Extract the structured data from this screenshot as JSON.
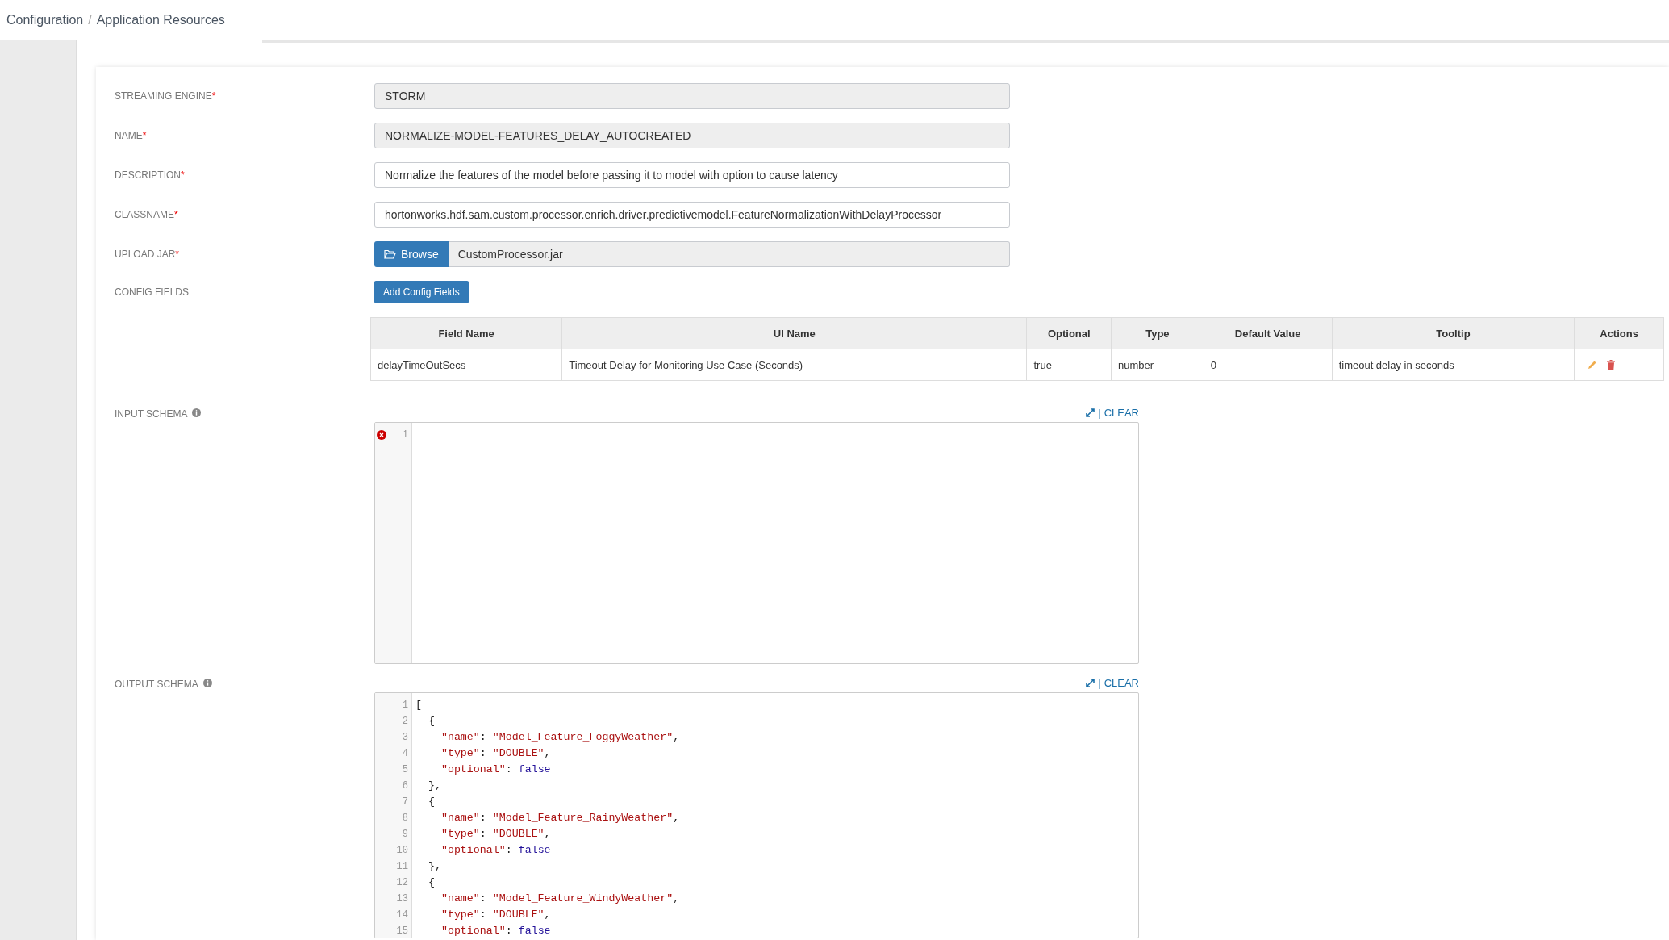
{
  "breadcrumb": [
    "Configuration",
    "Application Resources"
  ],
  "breadcrumb_separator": "/",
  "form": {
    "fields": [
      {
        "label": "STREAMING ENGINE",
        "required_mark": "*",
        "kind": "readonly",
        "value": "STORM"
      },
      {
        "label": "NAME",
        "required_mark": "*",
        "kind": "readonly",
        "value": "NORMALIZE-MODEL-FEATURES_DELAY_AUTOCREATED"
      },
      {
        "label": "DESCRIPTION",
        "required_mark": "*",
        "kind": "text",
        "value": "Normalize the features of the model before passing it to model with option to cause latency"
      },
      {
        "label": "CLASSNAME",
        "required_mark": "*",
        "kind": "text",
        "value": "hortonworks.hdf.sam.custom.processor.enrich.driver.predictivemodel.FeatureNormalizationWithDelayProcessor"
      },
      {
        "label": "UPLOAD JAR",
        "required_mark": "*",
        "kind": "file",
        "button": "Browse",
        "value": "CustomProcessor.jar"
      }
    ]
  },
  "config_fields": {
    "label": "CONFIG FIELDS",
    "button": "Add Config Fields",
    "columns": [
      "Field Name",
      "UI Name",
      "Optional",
      "Type",
      "Default Value",
      "Tooltip",
      "Actions"
    ],
    "rows": [
      {
        "cells": [
          "delayTimeOutSecs",
          "Timeout Delay for Monitoring Use Case (Seconds)",
          "true",
          "number",
          "0",
          "timeout delay in seconds"
        ]
      }
    ]
  },
  "schemas": [
    {
      "label": "INPUT SCHEMA",
      "separator": "|",
      "clear": "CLEAR",
      "error": true,
      "lines": [
        {
          "number": "1"
        }
      ]
    },
    {
      "label": "OUTPUT SCHEMA",
      "separator": "|",
      "clear": "CLEAR",
      "error": false,
      "lines": [
        {
          "number": "1",
          "tokens": [
            {
              "kind": "punct",
              "text": "["
            }
          ]
        },
        {
          "number": "2",
          "tokens": [
            {
              "kind": "punct",
              "text": "  {"
            }
          ]
        },
        {
          "number": "3",
          "tokens": [
            {
              "kind": "key",
              "text": "    \"name\""
            },
            {
              "kind": "punct",
              "text": ": "
            },
            {
              "kind": "string",
              "text": "\"Model_Feature_FoggyWeather\""
            },
            {
              "kind": "punct",
              "text": ","
            }
          ]
        },
        {
          "number": "4",
          "tokens": [
            {
              "kind": "key",
              "text": "    \"type\""
            },
            {
              "kind": "punct",
              "text": ": "
            },
            {
              "kind": "string",
              "text": "\"DOUBLE\""
            },
            {
              "kind": "punct",
              "text": ","
            }
          ]
        },
        {
          "number": "5",
          "tokens": [
            {
              "kind": "key",
              "text": "    \"optional\""
            },
            {
              "kind": "punct",
              "text": ": "
            },
            {
              "kind": "atom",
              "text": "false"
            }
          ]
        },
        {
          "number": "6",
          "tokens": [
            {
              "kind": "punct",
              "text": "  },"
            }
          ]
        },
        {
          "number": "7",
          "tokens": [
            {
              "kind": "punct",
              "text": "  {"
            }
          ]
        },
        {
          "number": "8",
          "tokens": [
            {
              "kind": "key",
              "text": "    \"name\""
            },
            {
              "kind": "punct",
              "text": ": "
            },
            {
              "kind": "string",
              "text": "\"Model_Feature_RainyWeather\""
            },
            {
              "kind": "punct",
              "text": ","
            }
          ]
        },
        {
          "number": "9",
          "tokens": [
            {
              "kind": "key",
              "text": "    \"type\""
            },
            {
              "kind": "punct",
              "text": ": "
            },
            {
              "kind": "string",
              "text": "\"DOUBLE\""
            },
            {
              "kind": "punct",
              "text": ","
            }
          ]
        },
        {
          "number": "10",
          "tokens": [
            {
              "kind": "key",
              "text": "    \"optional\""
            },
            {
              "kind": "punct",
              "text": ": "
            },
            {
              "kind": "atom",
              "text": "false"
            }
          ]
        },
        {
          "number": "11",
          "tokens": [
            {
              "kind": "punct",
              "text": "  },"
            }
          ]
        },
        {
          "number": "12",
          "tokens": [
            {
              "kind": "punct",
              "text": "  {"
            }
          ]
        },
        {
          "number": "13",
          "tokens": [
            {
              "kind": "key",
              "text": "    \"name\""
            },
            {
              "kind": "punct",
              "text": ": "
            },
            {
              "kind": "string",
              "text": "\"Model_Feature_WindyWeather\""
            },
            {
              "kind": "punct",
              "text": ","
            }
          ]
        },
        {
          "number": "14",
          "tokens": [
            {
              "kind": "key",
              "text": "    \"type\""
            },
            {
              "kind": "punct",
              "text": ": "
            },
            {
              "kind": "string",
              "text": "\"DOUBLE\""
            },
            {
              "kind": "punct",
              "text": ","
            }
          ]
        },
        {
          "number": "15",
          "tokens": [
            {
              "kind": "key",
              "text": "    \"optional\""
            },
            {
              "kind": "punct",
              "text": ": "
            },
            {
              "kind": "atom",
              "text": "false"
            }
          ]
        }
      ]
    }
  ]
}
